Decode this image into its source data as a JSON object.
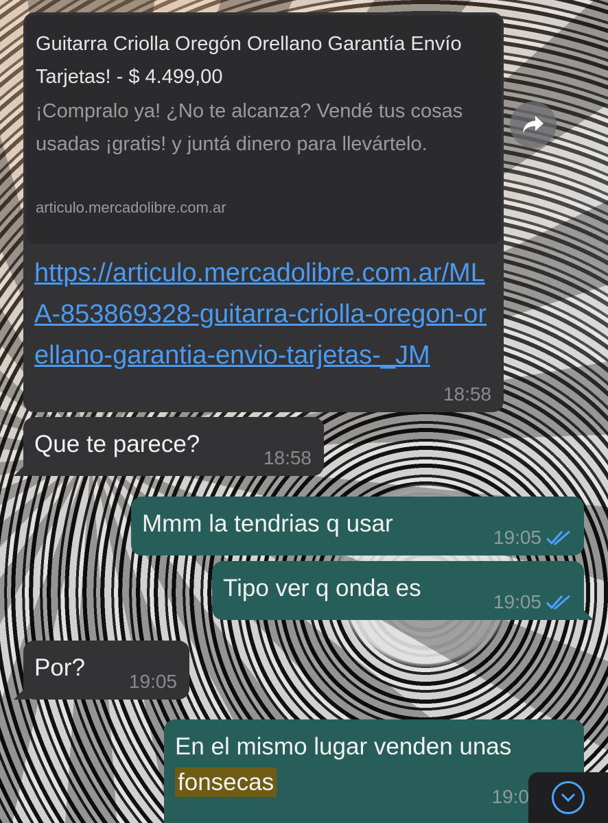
{
  "messages": [
    {
      "preview": {
        "title": "Guitarra Criolla Oregón Orellano Garantía Envío Tarjetas! - $ 4.499,00",
        "description": "¡Compralo ya! ¿No te alcanza? Vendé tus cosas usadas ¡gratis! y juntá dinero para llevártelo.",
        "domain": "articulo.mercadolibre.com.ar"
      },
      "link": "https://articulo.mercadolibre.com.ar/MLA-853869328-guitarra-criolla-oregon-orellano-garantia-envio-tarjetas-_JM",
      "time": "18:58"
    },
    {
      "text": "Que te parece?",
      "time": "18:58"
    },
    {
      "text": "Mmm la tendrias q usar",
      "time": "19:05"
    },
    {
      "text": "Tipo ver q onda es",
      "time": "19:05"
    },
    {
      "text": "Por?",
      "time": "19:05"
    },
    {
      "text_plain": "En el mismo lugar venden unas",
      "text_highlight": "fonsecas",
      "time": "19:0"
    }
  ],
  "icons": {
    "forward": "forward-arrow-icon",
    "read_receipt": "double-check-icon",
    "scroll_down": "chevron-down-icon"
  },
  "colors": {
    "incoming_bubble": "#333335",
    "outgoing_bubble": "#275e5a",
    "link": "#4b9bf2",
    "read_tick": "#4aa3ff",
    "highlight": "#6e5b14"
  }
}
